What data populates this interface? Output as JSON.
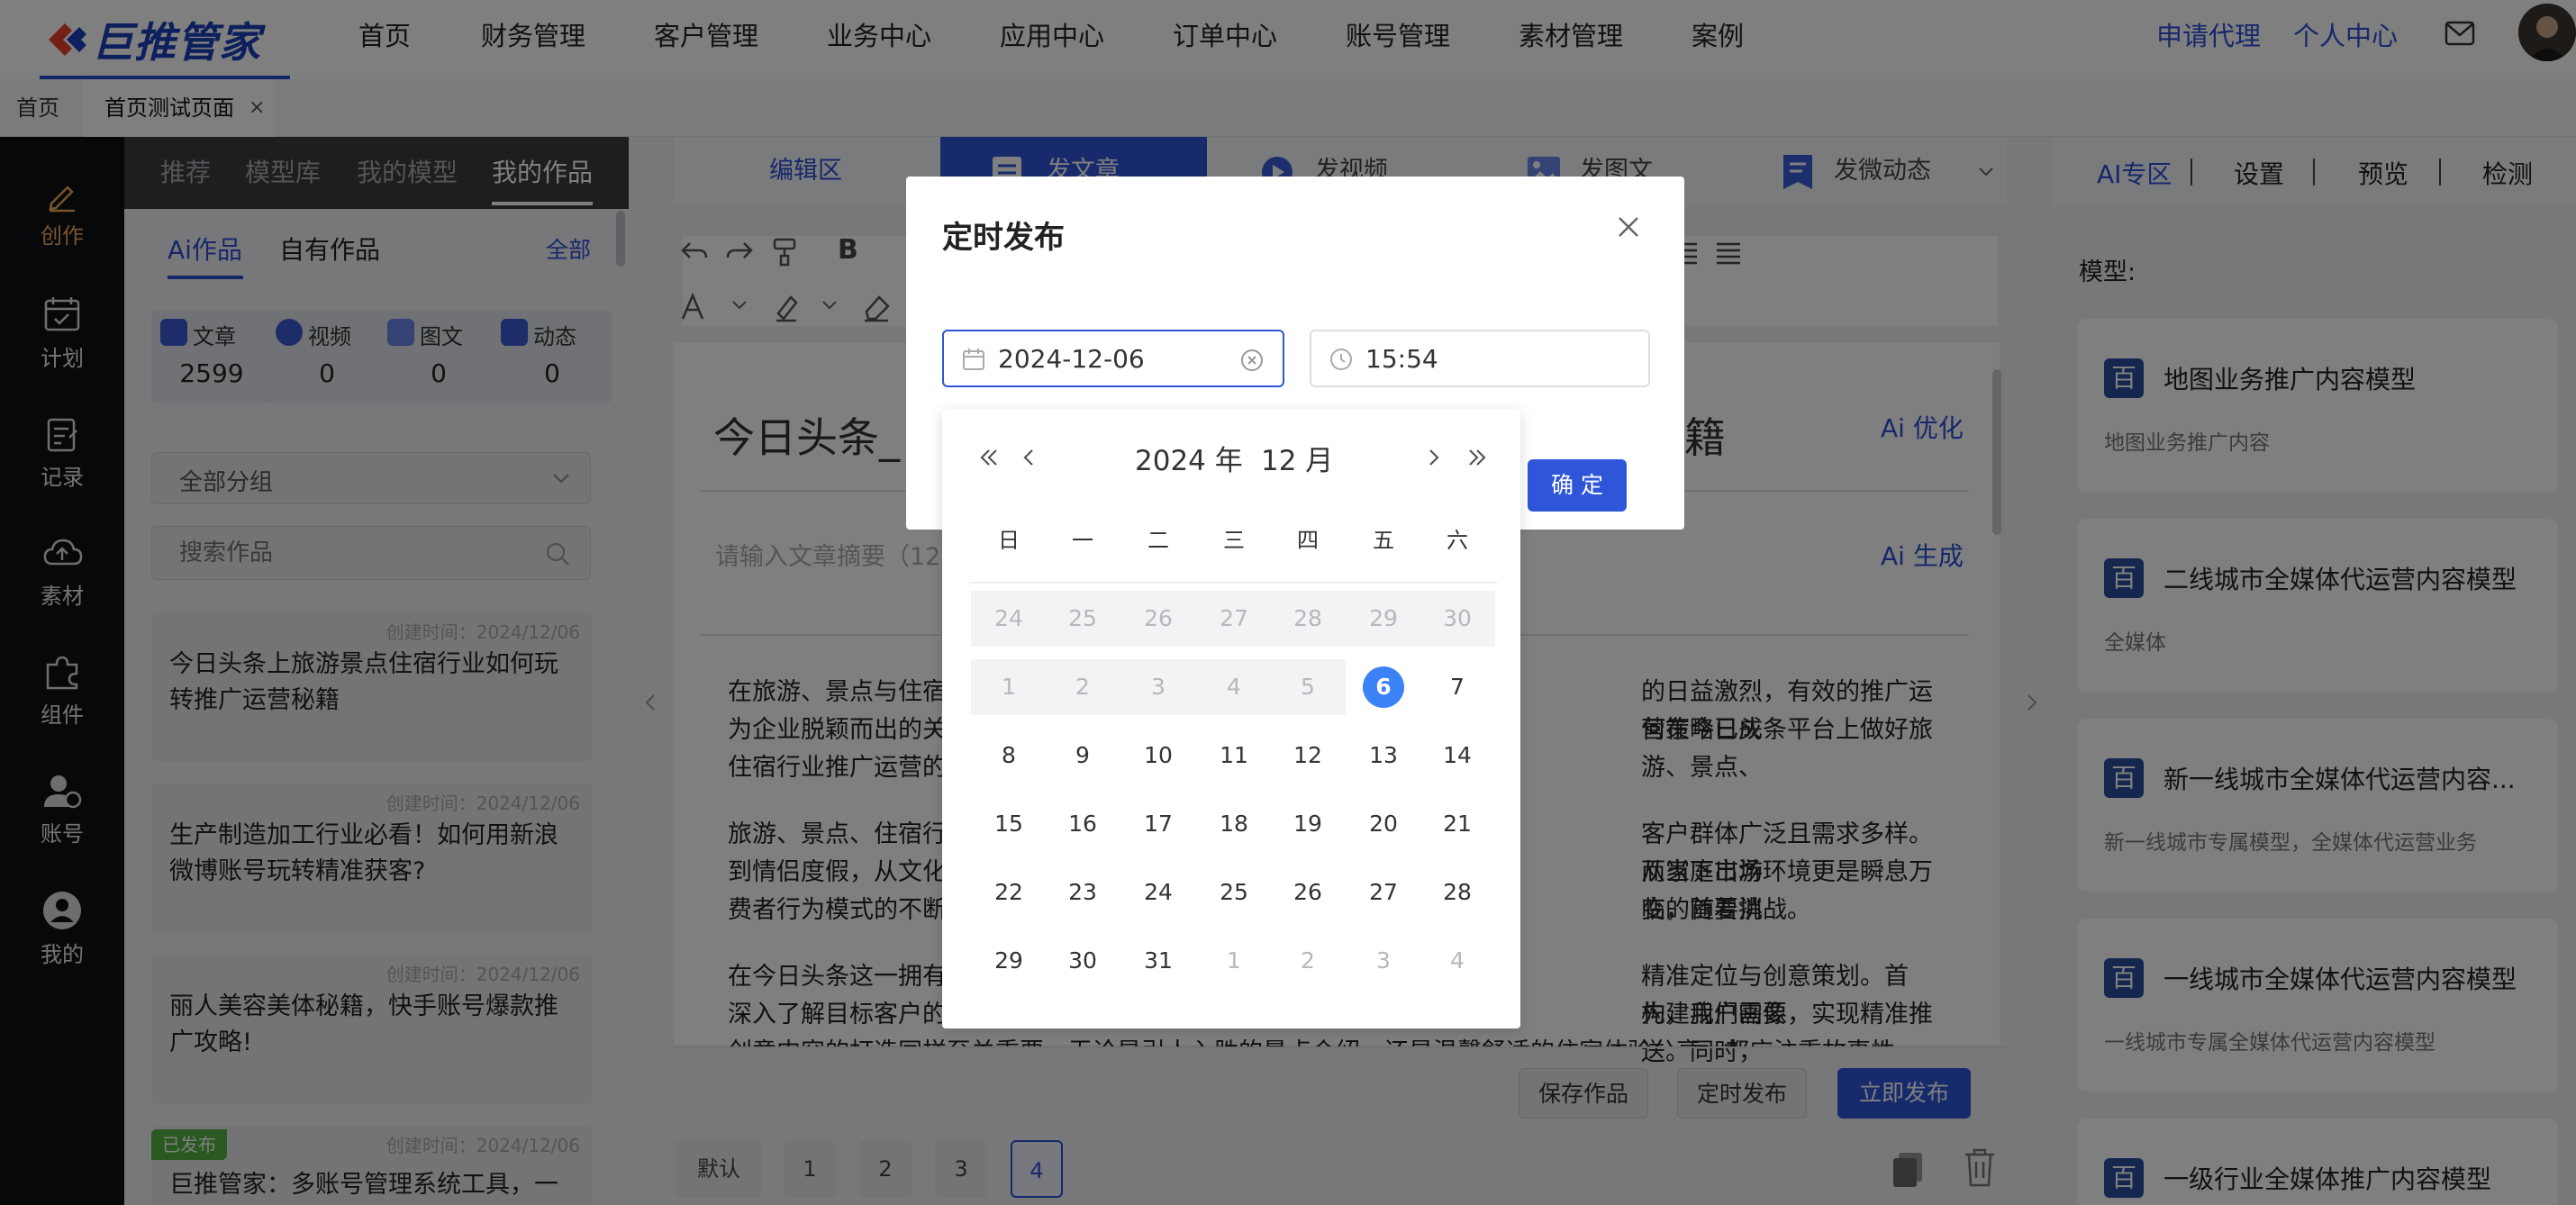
{
  "logo": {
    "text": "巨推管家"
  },
  "nav": {
    "items": [
      "首页",
      "财务管理",
      "客户管理",
      "业务中心",
      "应用中心",
      "订单中心",
      "账号管理",
      "素材管理",
      "案例"
    ],
    "apply_agent": "申请代理",
    "personal_center": "个人中心"
  },
  "tabs": {
    "home": "首页",
    "current": "首页测试页面",
    "close": "×"
  },
  "rail": {
    "items": [
      "创作",
      "计划",
      "记录",
      "素材",
      "组件",
      "账号",
      "我的"
    ]
  },
  "works": {
    "tabs": [
      "推荐",
      "模型库",
      "我的模型",
      "我的作品"
    ],
    "subtabs": [
      "Ai作品",
      "自有作品"
    ],
    "all_link": "全部",
    "stats": [
      {
        "label": "文章",
        "value": "2599"
      },
      {
        "label": "视频",
        "value": "0"
      },
      {
        "label": "图文",
        "value": "0"
      },
      {
        "label": "动态",
        "value": "0"
      }
    ],
    "group_select": "全部分组",
    "search_placeholder": "搜索作品",
    "cards": [
      {
        "date": "创建时间：2024/12/06",
        "title": "今日头条上旅游景点住宿行业如何玩转推广运营秘籍"
      },
      {
        "date": "创建时间：2024/12/06",
        "title": "生产制造加工行业必看！如何用新浪微博账号玩转精准获客?"
      },
      {
        "date": "创建时间：2024/12/06",
        "title": "丽人美容美体秘籍，快手账号爆款推广攻略!"
      },
      {
        "date": "创建时间：2024/12/06",
        "title": "巨推管家：多账号管理系统工具，一",
        "badge": "已发布"
      }
    ]
  },
  "editor": {
    "tabs": [
      "编辑区",
      "发文章",
      "发视频",
      "发图文",
      "发微动态"
    ],
    "title_partial_left": "今日头条_",
    "title_partial_right": "籍",
    "ai_optimize": "Ai 优化",
    "summary_placeholder": "请输入文章摘要（12",
    "ai_generate": "Ai 生成",
    "paragraphs": [
      {
        "left": "在旅游、景点与住宿",
        "right": "的日益激烈，有效的推广运营策略已成"
      },
      {
        "left": "为企业脱颖而出的关",
        "right": "何在今日头条平台上做好旅游、景点、"
      },
      {
        "left": "住宿行业推广运营的",
        "right": ""
      },
      {
        "left": "旅游、景点、住宿行",
        "right": "客户群体广泛且需求多样。从家庭出游"
      },
      {
        "left": "到情侣度假，从文化",
        "right": "而当下市场环境更是瞬息万变，随着消"
      },
      {
        "left": "费者行为模式的不断",
        "right": "临的首要挑战。"
      },
      {
        "left": "在今日头条这一拥有",
        "right": "精准定位与创意策划。首先，我们需要"
      },
      {
        "left": "深入了解目标客户的",
        "right": "构建用户画像，实现精准推送。同时，"
      },
      {
        "left": "创意内容的打造同样至关重要，无论是引人入胜的景点介绍，还是温馨舒适的住宿体验分享，都应注重故事性",
        "right": ""
      }
    ],
    "buttons": {
      "save": "保存作品",
      "schedule": "定时发布",
      "publish_now": "立即发布"
    },
    "pages": [
      "默认",
      "1",
      "2",
      "3",
      "4"
    ]
  },
  "right": {
    "tabs": [
      "AI专区",
      "设置",
      "预览",
      "检测"
    ],
    "model_label": "模型:",
    "models": [
      {
        "title": "地图业务推广内容模型",
        "desc": "地图业务推广内容"
      },
      {
        "title": "二线城市全媒体代运营内容模型",
        "desc": "全媒体"
      },
      {
        "title": "新一线城市全媒体代运营内容...",
        "desc": "新一线城市专属模型，全媒体代运营业务"
      },
      {
        "title": "一线城市全媒体代运营内容模型",
        "desc": "一线城市专属全媒体代运营内容模型"
      },
      {
        "title": "一级行业全媒体推广内容模型",
        "desc": ""
      }
    ],
    "badge_char": "百"
  },
  "modal": {
    "title": "定时发布",
    "date_value": "2024-12-06",
    "time_value": "15:54",
    "confirm": "确 定",
    "calendar": {
      "year_label": "2024 年",
      "month_label": "12 月",
      "weekdays": [
        "日",
        "一",
        "二",
        "三",
        "四",
        "五",
        "六"
      ],
      "selected": "6",
      "rows": [
        [
          "24",
          "25",
          "26",
          "27",
          "28",
          "29",
          "30"
        ],
        [
          "1",
          "2",
          "3",
          "4",
          "5",
          "6",
          "7"
        ],
        [
          "8",
          "9",
          "10",
          "11",
          "12",
          "13",
          "14"
        ],
        [
          "15",
          "16",
          "17",
          "18",
          "19",
          "20",
          "21"
        ],
        [
          "22",
          "23",
          "24",
          "25",
          "26",
          "27",
          "28"
        ],
        [
          "29",
          "30",
          "31",
          "1",
          "2",
          "3",
          "4"
        ]
      ]
    }
  },
  "colors": {
    "primary": "#2b4fd8",
    "selected_day": "#3b82f6",
    "rail_bg": "#0f1115",
    "publish_tab": "#2f56d8"
  }
}
